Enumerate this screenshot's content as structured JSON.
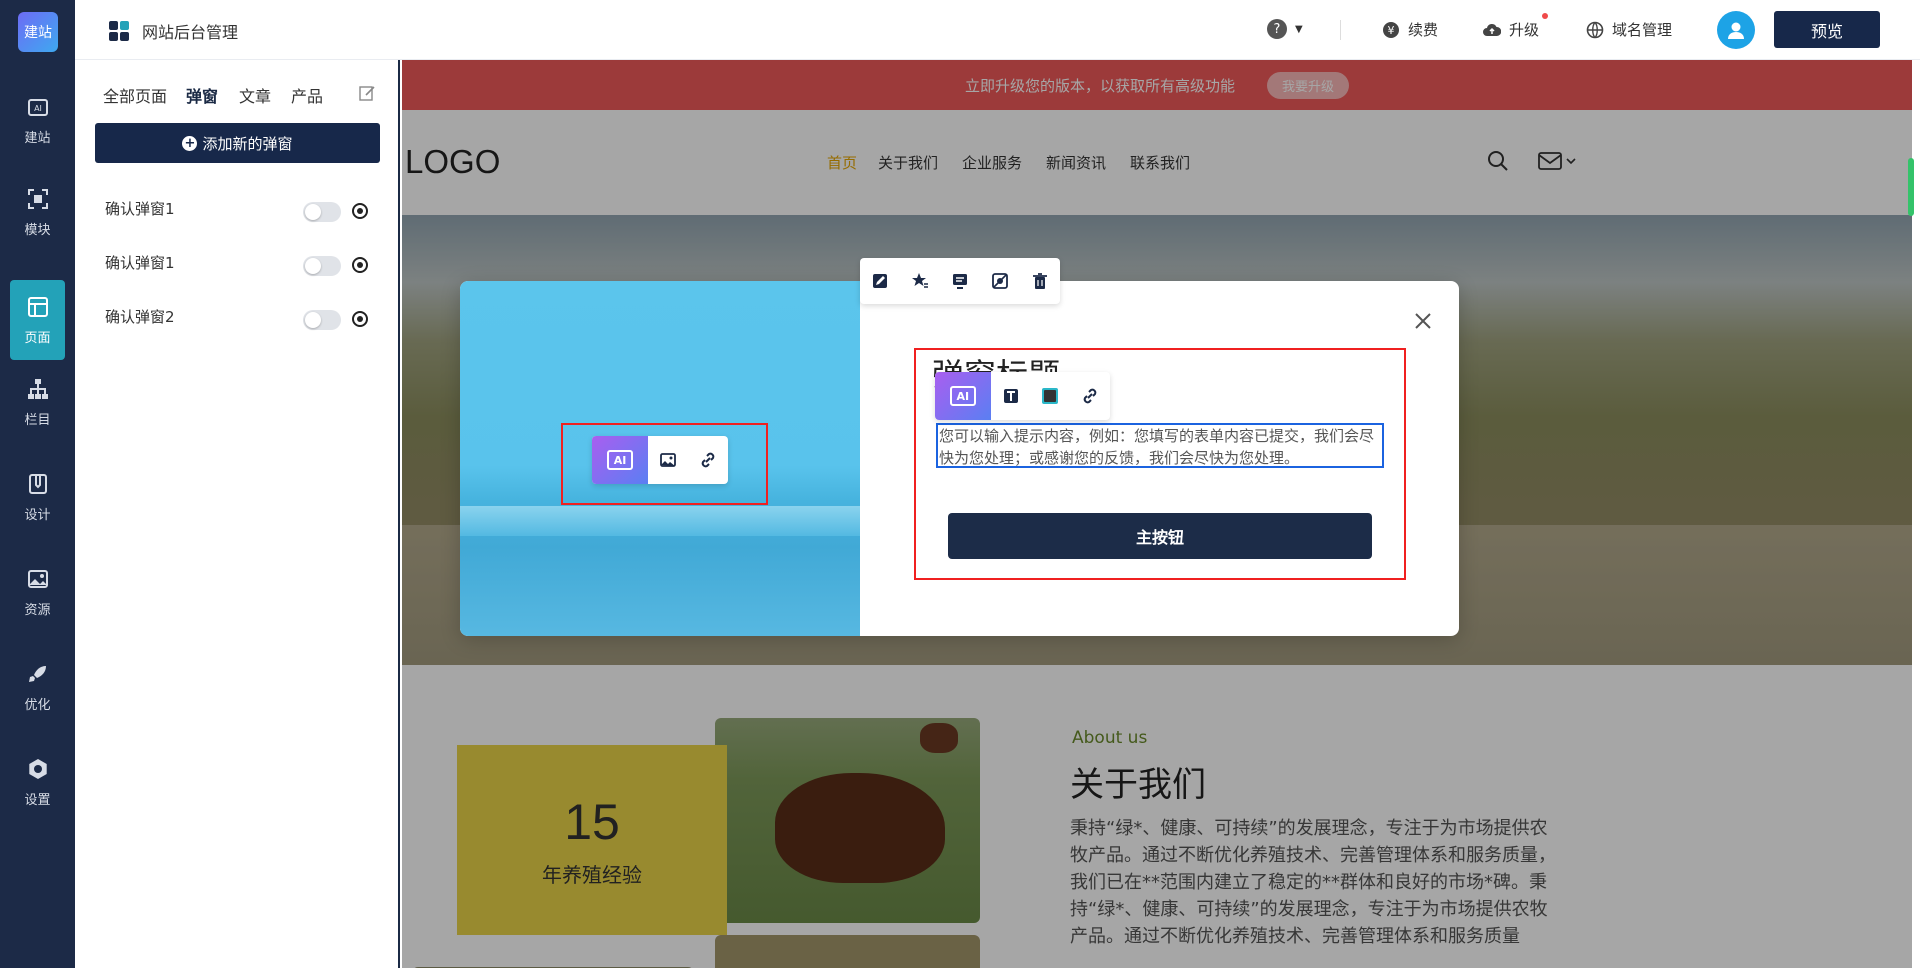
{
  "rail": {
    "logo": "建站",
    "items": [
      {
        "label": "建站",
        "icon": "ai-icon"
      },
      {
        "label": "模块",
        "icon": "module-icon"
      },
      {
        "label": "页面",
        "icon": "page-icon"
      },
      {
        "label": "栏目",
        "icon": "sitemap-icon"
      },
      {
        "label": "设计",
        "icon": "design-icon"
      },
      {
        "label": "资源",
        "icon": "image-icon"
      },
      {
        "label": "优化",
        "icon": "rocket-icon"
      },
      {
        "label": "设置",
        "icon": "settings-icon"
      }
    ],
    "active_index": 2,
    "active_color": "#23a2b8",
    "bg_color": "#1c2a47"
  },
  "topbar": {
    "title": "网站后台管理",
    "help": "?",
    "renew": "续费",
    "upgrade": "升级",
    "domain": "域名管理",
    "preview": "预览"
  },
  "panel": {
    "tabs": [
      "全部页面",
      "弹窗",
      "文章",
      "产品"
    ],
    "active_tab": 1,
    "add_button": "添加新的弹窗",
    "popups": [
      {
        "name": "确认弹窗1",
        "enabled": false
      },
      {
        "name": "确认弹窗1",
        "enabled": false
      },
      {
        "name": "确认弹窗2",
        "enabled": false
      }
    ]
  },
  "site": {
    "banner_text": "立即升级您的版本，以获取所有高级功能",
    "banner_button": "我要升级",
    "logo": "LOGO",
    "nav": [
      "首页",
      "关于我们",
      "企业服务",
      "新闻资讯",
      "联系我们"
    ],
    "nav_active": 0,
    "years": "15",
    "years_label": "年养殖经验",
    "about_sub": "About us",
    "about_title": "关于我们",
    "about_body": "秉持“绿*、健康、可持续”的发展理念，专注于为市场提供农牧产品。通过不断优化养殖技术、完善管理体系和服务质量，我们已在**范围内建立了稳定的**群体和良好的市场*碑。秉持“绿*、健康、可持续”的发展理念，专注于为市场提供农牧产品。通过不断优化养殖技术、完善管理体系和服务质量"
  },
  "modal": {
    "title": "弹窗标题",
    "text": "您可以输入提示内容，例如：您填写的表单内容已提交，我们会尽快为您处理；或感谢您的反馈，我们会尽快为您处理。",
    "primary_button": "主按钮",
    "ai_label": "AI"
  }
}
